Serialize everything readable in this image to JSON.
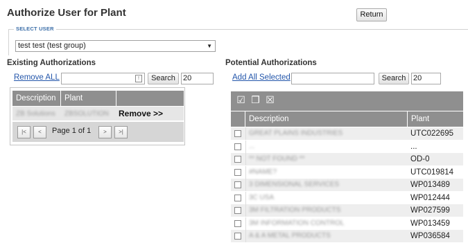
{
  "header": {
    "title": "Authorize User for Plant",
    "return_label": "Return"
  },
  "select_user": {
    "legend": "SELECT USER",
    "value": "test test (test group)"
  },
  "existing": {
    "title": "Existing Authorizations",
    "remove_all_label": "Remove ALL",
    "search_label": "Search",
    "page_size": "20",
    "columns": [
      "Description",
      "Plant"
    ],
    "row": {
      "description": "ZB Solutions",
      "plant": "ZBSOLUTION",
      "action": "Remove >>"
    },
    "pager": {
      "first": "|<",
      "prev": "<",
      "text": "Page 1 of 1",
      "next": ">",
      "last": ">|"
    }
  },
  "potential": {
    "title": "Potential Authorizations",
    "add_all_label": "Add All Selected",
    "search_label": "Search",
    "page_size": "20",
    "toolbar_icons": [
      "select-all-icon",
      "select-page-icon",
      "deselect-icon"
    ],
    "columns": [
      "Description",
      "Plant"
    ],
    "rows": [
      {
        "description": "GREAT PLAINS INDUSTRIES",
        "plant": "UTC022695"
      },
      {
        "description": "...",
        "plant": "..."
      },
      {
        "description": "** NOT FOUND **",
        "plant": "OD-0"
      },
      {
        "description": "#NAME?",
        "plant": "UTC019814"
      },
      {
        "description": "3 DIMENSIONAL SERVICES",
        "plant": "WP013489"
      },
      {
        "description": "3C USA",
        "plant": "WP012444"
      },
      {
        "description": "3M FILTRATION PRODUCTS",
        "plant": "WP027599"
      },
      {
        "description": "3M INFORMATION CONTROL",
        "plant": "WP013459"
      },
      {
        "description": "A & A METAL PRODUCTS",
        "plant": "WP036584"
      }
    ]
  }
}
